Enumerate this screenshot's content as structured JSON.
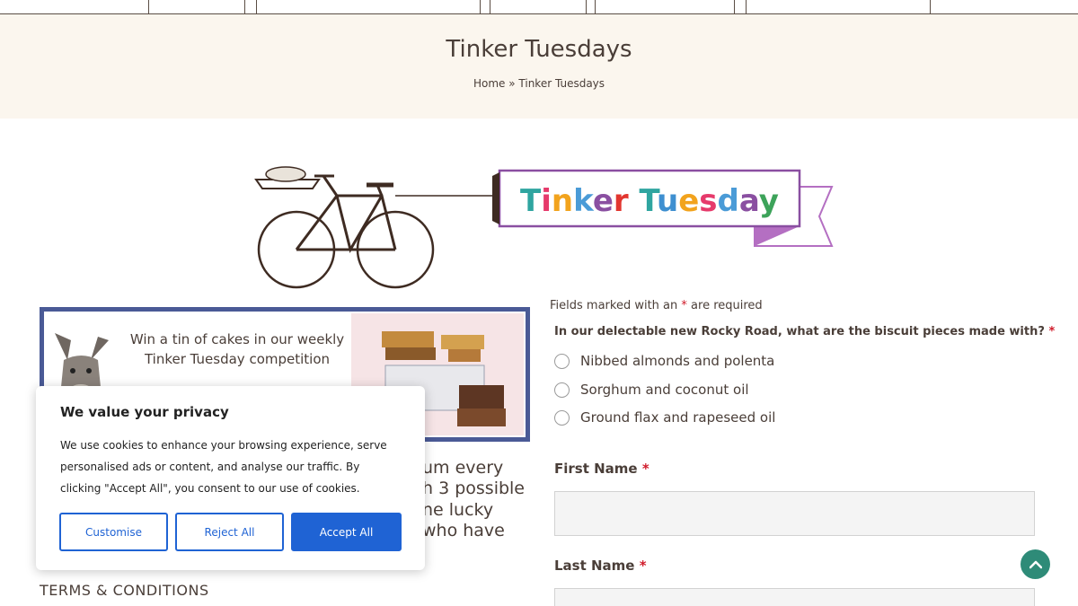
{
  "page": {
    "title": "Tinker Tuesdays",
    "breadcrumb": {
      "home": "Home",
      "separator": "»",
      "current": "Tinker Tuesdays"
    }
  },
  "illustration": {
    "banner_text": "Tinker Tuesday",
    "letter_colors": [
      "#2fa5a0",
      "#e63a6b",
      "#f2a31d",
      "#4a9bd7",
      "#8a4fa1",
      "#e2362f",
      "#2fa5a0",
      "#3e8fd0",
      "#f2a31d",
      "#e63a6b",
      "#4a9bd7",
      "#8a4fa1",
      "#3da35a",
      "#f2a31d"
    ]
  },
  "promo": {
    "heading": "Win a tin of cakes in our weekly Tinker Tuesday competition"
  },
  "body_fragments": [
    "um every",
    "h 3 possible",
    "ne lucky",
    "who have"
  ],
  "terms_heading": "TERMS & CONDITIONS",
  "cookie": {
    "title": "We value your privacy",
    "text": "We use cookies to enhance your browsing experience, serve personalised ads or content, and analyse our traffic. By clicking \"Accept All\", you consent to our use of cookies.",
    "customise": "Customise",
    "reject": "Reject All",
    "accept": "Accept All"
  },
  "form": {
    "note_prefix": "Fields marked with an",
    "note_suffix": "are required",
    "required_mark": "*",
    "question": "In our delectable new Rocky Road, what are the biscuit pieces made with?",
    "options": [
      "Nibbed almonds and polenta",
      "Sorghum and coconut oil",
      "Ground flax and rapeseed oil"
    ],
    "first_name_label": "First Name",
    "last_name_label": "Last Name"
  },
  "colors": {
    "accent": "#1f63d4",
    "brand_text": "#4a3e38",
    "hero_bg": "#fbf6ee",
    "promo_border": "#4a5a96",
    "back_to_top": "#2e8b78",
    "required": "#d01b2a"
  }
}
